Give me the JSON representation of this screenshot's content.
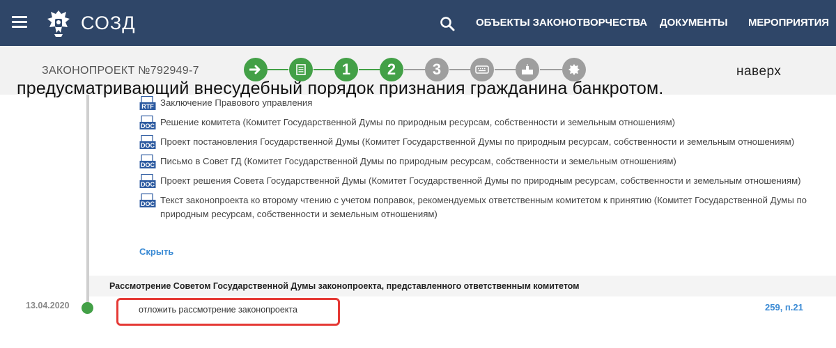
{
  "header": {
    "brand": "СОЗД",
    "nav": [
      {
        "label": "ОБЪЕКТЫ ЗАКОНОТВОРЧЕСТВА"
      },
      {
        "label": "ДОКУМЕНТЫ"
      },
      {
        "label": "МЕРОПРИЯТИЯ"
      }
    ],
    "icons": {
      "menu": "hamburger-icon",
      "emblem": "emblem-icon",
      "search": "search-icon"
    }
  },
  "bill": {
    "number": "ЗАКОНОПРОЕКТ №792949-7",
    "up_link": "наверх",
    "steps": [
      {
        "icon": "arrow-right-icon",
        "status": "done"
      },
      {
        "icon": "document-icon",
        "status": "done"
      },
      {
        "label": "1",
        "status": "done"
      },
      {
        "label": "2",
        "status": "done"
      },
      {
        "label": "3",
        "status": "pending"
      },
      {
        "icon": "keyboard-icon",
        "status": "pending"
      },
      {
        "icon": "building-icon",
        "status": "pending"
      },
      {
        "icon": "emblem-icon",
        "status": "pending"
      }
    ],
    "colors": {
      "done": "#43a047",
      "pending": "#9e9e9e"
    }
  },
  "overlay_title": "предусматривающий внесудебный порядок признания гражданина банкротом.",
  "documents": [
    {
      "type": "RTF",
      "text": "Заключение Правового управления"
    },
    {
      "type": "DOC",
      "text": "Решение комитета (Комитет Государственной Думы по природным ресурсам, собственности и земельным отношениям)"
    },
    {
      "type": "DOC",
      "text": "Проект постановления Государственной Думы (Комитет Государственной Думы по природным ресурсам, собственности и земельным отношениям)"
    },
    {
      "type": "DOC",
      "text": "Письмо в Совет ГД (Комитет Государственной Думы по природным ресурсам, собственности и земельным отношениям)"
    },
    {
      "type": "DOC",
      "text": "Проект решения Совета Государственной Думы (Комитет Государственной Думы по природным ресурсам, собственности и земельным отношениям)"
    },
    {
      "type": "DOC",
      "text": "Текст законопроекта ко второму чтению с учетом поправок, рекомендуемых ответственным комитетом к принятию (Комитет Государственной Думы по природным ресурсам, собственности и земельным отношениям)"
    }
  ],
  "hide_link": "Скрыть",
  "stage": {
    "title": "Рассмотрение Советом Государственной Думы законопроекта, представленного ответственным комитетом"
  },
  "event": {
    "date": "13.04.2020",
    "decision": "отложить рассмотрение законопроекта",
    "meeting_ref": "259, п.21"
  },
  "theme": {
    "header_bg": "#2f4668",
    "link": "#3a8ad4",
    "highlight": "#e53935"
  }
}
